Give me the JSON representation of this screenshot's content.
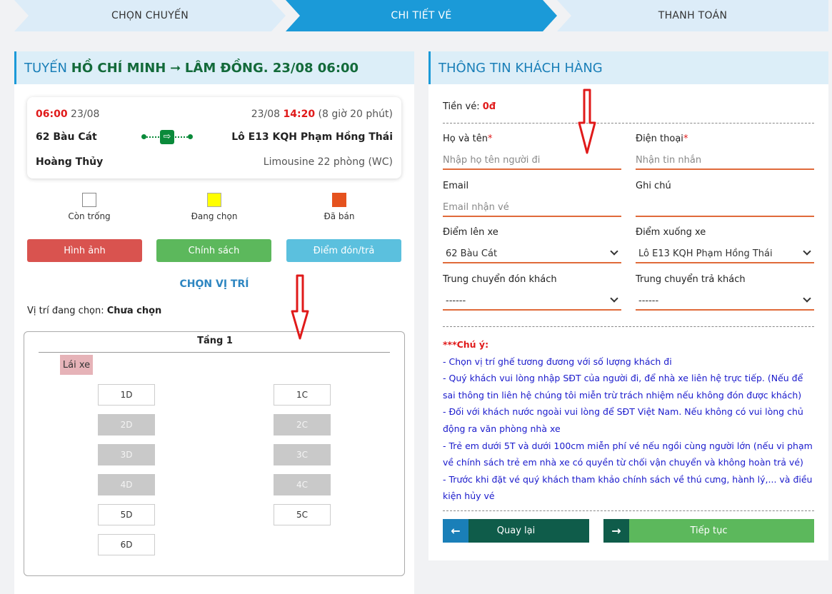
{
  "steps": [
    {
      "label": "CHỌN CHUYẾN"
    },
    {
      "label": "CHI TIẾT VÉ"
    },
    {
      "label": "THANH TOÁN"
    }
  ],
  "route": {
    "prefix": "TUYẾN",
    "from": "HỒ CHÍ MINH",
    "arrow": "➞",
    "to": "LÂM ĐỒNG",
    "datetime": ". 23/08 06:00"
  },
  "trip": {
    "depart_time": "06:00",
    "depart_date": "23/08",
    "arrive_date": "23/08",
    "arrive_time": "14:20",
    "duration": "(8 giờ 20 phút)",
    "origin": "62 Bàu Cát",
    "destination": "Lô E13 KQH Phạm Hồng Thái",
    "operator": "Hoàng Thủy",
    "vehicle": "Limousine 22 phòng (WC)",
    "bus_icon": "⇨"
  },
  "legend": [
    {
      "label": "Còn trống",
      "color": "#ffffff"
    },
    {
      "label": "Đang chọn",
      "color": "#ffff00"
    },
    {
      "label": "Đã bán",
      "color": "#e5521e"
    }
  ],
  "buttons": {
    "images": "Hình ảnh",
    "policy": "Chính sách",
    "pickup": "Điểm đón/trả",
    "back": "Quay lại",
    "next": "Tiếp tục",
    "back_icon": "←",
    "next_icon": "→"
  },
  "seat_section": {
    "title": "CHỌN VỊ TRÍ",
    "current_label": "Vị trí đang chọn: ",
    "current_value": "Chưa chọn",
    "floor": "Tầng 1",
    "driver": "Lái xe",
    "seats": [
      {
        "id": "1D",
        "status": "available"
      },
      {
        "id": "1C",
        "status": "available"
      },
      {
        "id": "2D",
        "status": "sold"
      },
      {
        "id": "2C",
        "status": "sold"
      },
      {
        "id": "3D",
        "status": "sold"
      },
      {
        "id": "3C",
        "status": "sold"
      },
      {
        "id": "4D",
        "status": "sold"
      },
      {
        "id": "4C",
        "status": "sold"
      },
      {
        "id": "5D",
        "status": "available"
      },
      {
        "id": "5C",
        "status": "available"
      },
      {
        "id": "6D",
        "status": "available"
      }
    ]
  },
  "customer": {
    "header": "THÔNG TIN KHÁCH HÀNG",
    "price_label": "Tiền vé: ",
    "price_value": "0đ",
    "name_label": "Họ và tên",
    "name_placeholder": "Nhập họ tên người đi",
    "phone_label": "Điện thoại",
    "phone_placeholder": "Nhận tin nhắn",
    "email_label": "Email",
    "email_placeholder": "Email nhận vé",
    "note_label": "Ghi chú",
    "note_placeholder": "",
    "required_mark": "*",
    "pickup_label": "Điểm lên xe",
    "pickup_value": "62 Bàu Cát",
    "dropoff_label": "Điểm xuống xe",
    "dropoff_value": "Lô E13 KQH Phạm Hồng Thái",
    "transfer_pickup_label": "Trung chuyển đón khách",
    "transfer_pickup_value": "------",
    "transfer_drop_label": "Trung chuyển trả khách",
    "transfer_drop_value": "------"
  },
  "notes": {
    "title": "***Chú ý:",
    "lines": [
      "- Chọn vị trí ghế tương đương với số lượng khách đi",
      "- Quý khách vui lòng nhập SĐT của người đi, để nhà xe liên hệ trực tiếp. (Nếu để sai thông tin liên hệ chúng tôi miễn trừ trách nhiệm nếu không đón được khách)",
      "- Đối với khách nước ngoài vui lòng để SĐT Việt Nam. Nếu không có vui lòng chủ động ra văn phòng nhà xe",
      "- Trẻ em dưới 5T và dưới 100cm miễn phí vé nếu ngồi cùng người lớn (nếu vi phạm về chính sách trẻ em nhà xe có quyền từ chối vận chuyển và không hoàn trả vé)",
      "- Trước khi đặt vé quý khách tham khảo chính sách về thú cưng, hành lý,... và điều kiện hủy vé"
    ]
  },
  "colors": {
    "accent": "#1b9ad8",
    "annotation": "#e01a1a"
  }
}
